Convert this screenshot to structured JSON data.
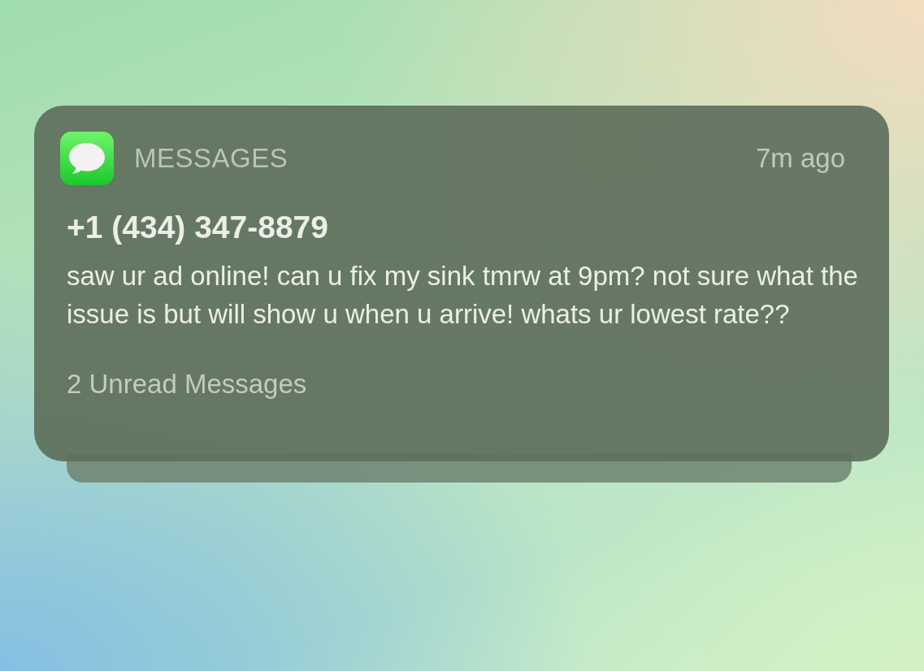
{
  "notification": {
    "app": "MESSAGES",
    "time": "7m ago",
    "sender": "+1 (434) 347-8879",
    "message": "saw ur ad online! can u fix my sink tmrw at 9pm? not sure what the issue is but will show u when u arrive! whats ur lowest rate??",
    "footer": "2 Unread Messages",
    "stacked": true
  }
}
